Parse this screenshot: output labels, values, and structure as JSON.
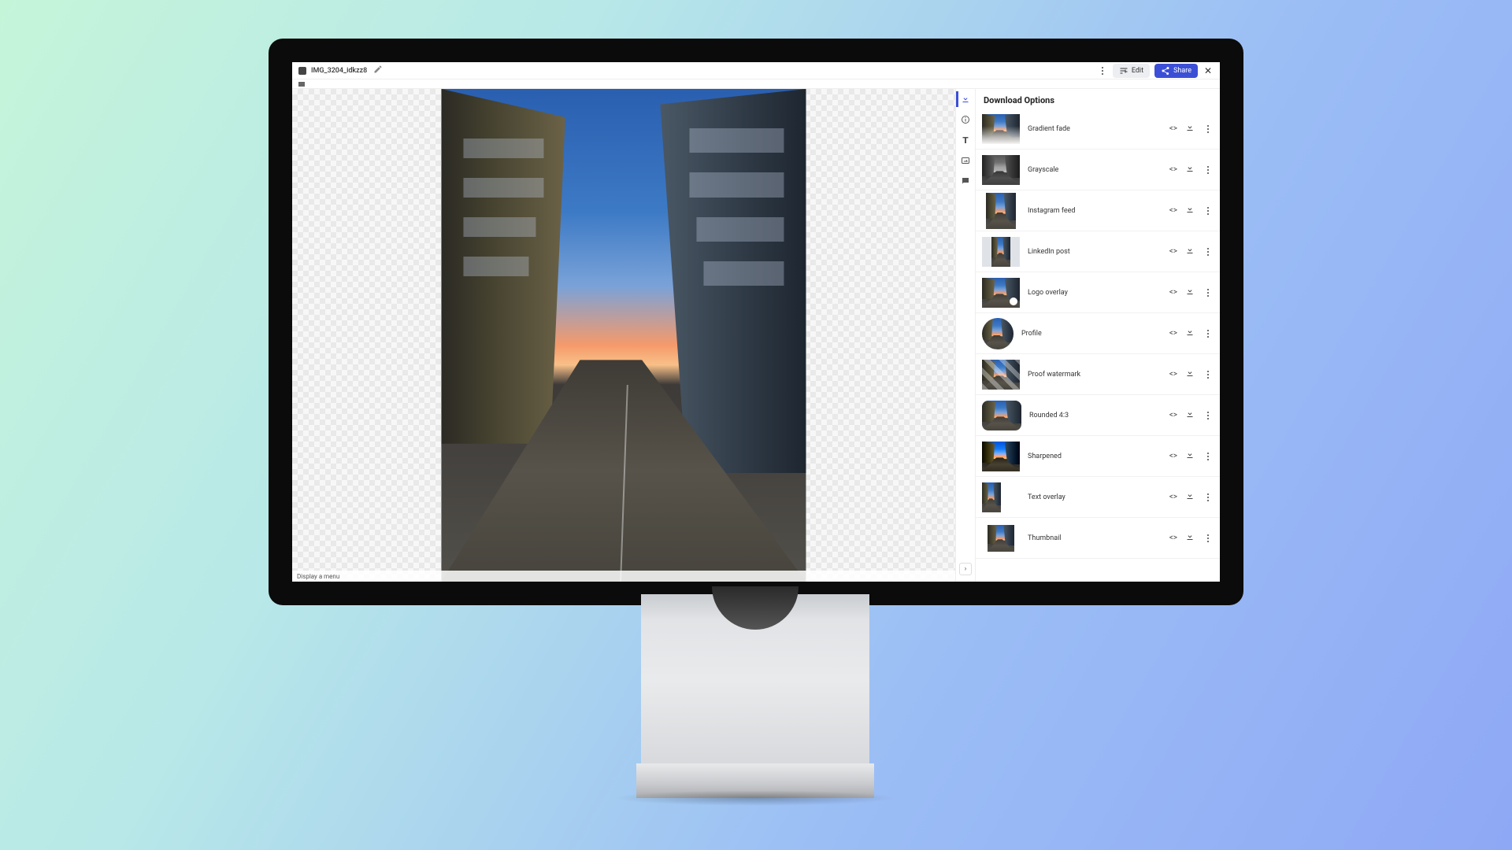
{
  "header": {
    "filename": "IMG_3204_idkzz8",
    "edit_label": "Edit",
    "share_label": "Share"
  },
  "statusbar": {
    "hint": "Display a menu"
  },
  "panel": {
    "title": "Download Options",
    "options": [
      {
        "label": "Gradient fade",
        "variant": "v-gradientfade"
      },
      {
        "label": "Grayscale",
        "variant": "v-grayscale"
      },
      {
        "label": "Instagram feed",
        "variant": "v-instagram"
      },
      {
        "label": "LinkedIn post",
        "variant": "v-linkedin"
      },
      {
        "label": "Logo overlay",
        "variant": "v-logo"
      },
      {
        "label": "Profile",
        "variant": "v-profile"
      },
      {
        "label": "Proof watermark",
        "variant": "v-proof"
      },
      {
        "label": "Rounded 4:3",
        "variant": "v-rounded"
      },
      {
        "label": "Sharpened",
        "variant": "v-sharp"
      },
      {
        "label": "Text overlay",
        "variant": "v-text"
      },
      {
        "label": "Thumbnail",
        "variant": "v-thumb"
      }
    ]
  },
  "rail": {
    "tools": [
      {
        "name": "download-icon",
        "active": true
      },
      {
        "name": "info-icon",
        "active": false
      },
      {
        "name": "text-icon",
        "active": false
      },
      {
        "name": "image-icon",
        "active": false
      },
      {
        "name": "comment-icon",
        "active": false
      }
    ]
  }
}
